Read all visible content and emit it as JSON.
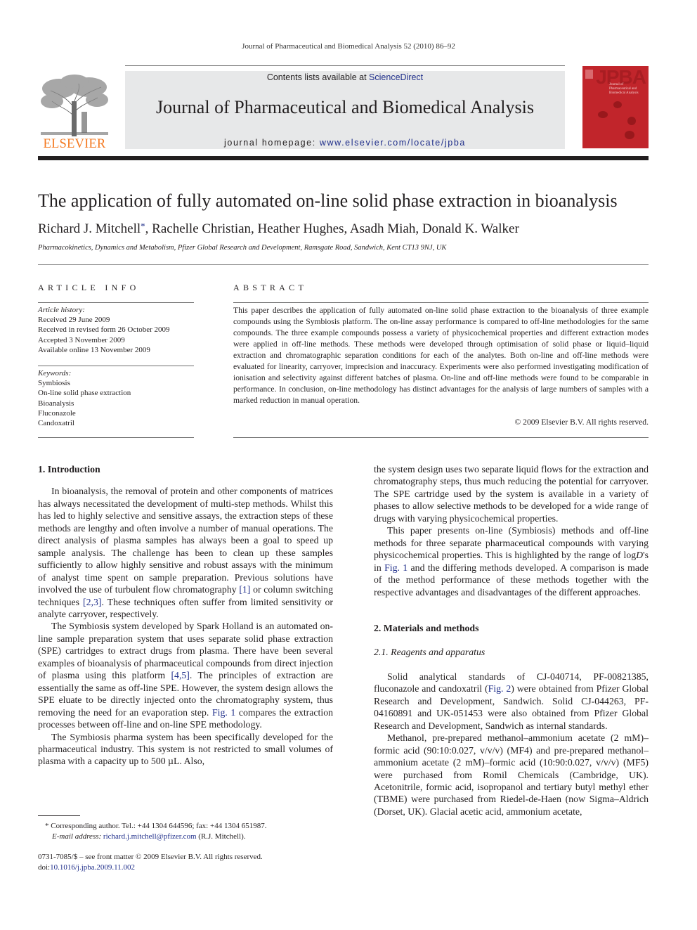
{
  "running_head": "Journal of Pharmaceutical and Biomedical Analysis 52 (2010) 86–92",
  "masthead": {
    "publisher_logo": "elsevier-tree-logo",
    "publisher_name": "ELSEVIER",
    "contents_prefix": "Contents lists available at ",
    "contents_link": "ScienceDirect",
    "journal_title": "Journal of Pharmaceutical and Biomedical Analysis",
    "homepage_prefix": "journal homepage: ",
    "homepage_link": "www.elsevier.com/locate/jpba",
    "cover_title": "JPBA",
    "cover_subtitle": "Journal of Pharmaceutical and Biomedical Analysis",
    "brand_orange": "#f47920",
    "cover_red": "#c1252b",
    "link_color": "#1f2e8a"
  },
  "article": {
    "title": "The application of fully automated on-line solid phase extraction in bioanalysis",
    "authors_first": "Richard J. Mitchell",
    "corresponding_mark": "*",
    "authors_rest": ", Rachelle Christian, Heather Hughes, Asadh Miah, Donald K. Walker",
    "affiliation": "Pharmacokinetics, Dynamics and Metabolism, Pfizer Global Research and Development, Ramsgate Road, Sandwich, Kent CT13 9NJ, UK"
  },
  "article_info": {
    "heading": "ARTICLE INFO",
    "history_label": "Article history:",
    "history": [
      "Received 29 June 2009",
      "Received in revised form 26 October 2009",
      "Accepted 3 November 2009",
      "Available online 13 November 2009"
    ],
    "keywords_label": "Keywords:",
    "keywords": [
      "Symbiosis",
      "On-line solid phase extraction",
      "Bioanalysis",
      "Fluconazole",
      "Candoxatril"
    ]
  },
  "abstract": {
    "heading": "ABSTRACT",
    "text": "This paper describes the application of fully automated on-line solid phase extraction to the bioanalysis of three example compounds using the Symbiosis platform. The on-line assay performance is compared to off-line methodologies for the same compounds. The three example compounds possess a variety of physicochemical properties and different extraction modes were applied in off-line methods. These methods were developed through optimisation of solid phase or liquid–liquid extraction and chromatographic separation conditions for each of the analytes. Both on-line and off-line methods were evaluated for linearity, carryover, imprecision and inaccuracy. Experiments were also performed investigating modification of ionisation and selectivity against different batches of plasma. On-line and off-line methods were found to be comparable in performance. In conclusion, on-line methodology has distinct advantages for the analysis of large numbers of samples with a marked reduction in manual operation.",
    "copyright": "© 2009 Elsevier B.V. All rights reserved."
  },
  "body": {
    "sec1_heading": "1.  Introduction",
    "p1_a": "In bioanalysis, the removal of protein and other components of matrices has always necessitated the development of multi-step methods. Whilst this has led to highly selective and sensitive assays, the extraction steps of these methods are lengthy and often involve a number of manual operations. The direct analysis of plasma samples has always been a goal to speed up sample analysis. The challenge has been to clean up these samples sufficiently to allow highly sensitive and robust assays with the minimum of analyst time spent on sample preparation. Previous solutions have involved the use of turbulent flow chromatography ",
    "p1_ref1": "[1]",
    "p1_b": " or column switching techniques ",
    "p1_ref2": "[2,3]",
    "p1_c": ". These techniques often suffer from limited sensitivity or analyte carryover, respectively.",
    "p2_a": "The Symbiosis system developed by Spark Holland is an automated on-line sample preparation system that uses separate solid phase extraction (SPE) cartridges to extract drugs from plasma. There have been several examples of bioanalysis of pharmaceutical compounds from direct injection of plasma using this platform ",
    "p2_ref": "[4,5]",
    "p2_b": ". The principles of extraction are essentially the same as off-line SPE. However, the system design allows the SPE eluate to be directly injected onto the chromatography system, thus removing the need for an evaporation step. ",
    "p2_fig": "Fig. 1",
    "p2_c": " compares the extraction processes between off-line and on-line SPE methodology.",
    "p3": "The Symbiosis pharma system has been specifically developed for the pharmaceutical industry. This system is not restricted to small volumes of plasma with a capacity up to 500 µL. Also,",
    "p4": "the system design uses two separate liquid flows for the extraction and chromatography steps, thus much reducing the potential for carryover. The SPE cartridge used by the system is available in a variety of phases to allow selective methods to be developed for a wide range of drugs with varying physicochemical properties.",
    "p5_a": "This paper presents on-line (Symbiosis) methods and off-line methods for three separate pharmaceutical compounds with varying physicochemical properties. This is highlighted by the range of log",
    "p5_d": "D",
    "p5_b": "'s in ",
    "p5_fig": "Fig. 1",
    "p5_c": " and the differing methods developed. A comparison is made of the method performance of these methods together with the respective advantages and disadvantages of the different approaches.",
    "sec2_heading": "2.  Materials and methods",
    "sub21_heading": "2.1.  Reagents and apparatus",
    "p6_a": "Solid analytical standards of CJ-040714, PF-00821385, fluconazole and candoxatril (",
    "p6_fig": "Fig. 2",
    "p6_b": ") were obtained from Pfizer Global Research and Development, Sandwich. Solid CJ-044263, PF-04160891 and UK-051453 were also obtained from Pfizer Global Research and Development, Sandwich as internal standards.",
    "p7": "Methanol, pre-prepared methanol–ammonium acetate (2 mM)–formic acid (90:10:0.027, v/v/v) (MF4) and pre-prepared methanol–ammonium acetate (2 mM)–formic acid (10:90:0.027, v/v/v) (MF5) were purchased from Romil Chemicals (Cambridge, UK). Acetonitrile, formic acid, isopropanol and tertiary butyl methyl ether (TBME) were purchased from Riedel-de-Haen (now Sigma–Aldrich (Dorset, UK). Glacial acetic acid, ammonium acetate,"
  },
  "footnote": {
    "mark": "*",
    "text": " Corresponding author. Tel.: +44 1304 644596; fax: +44 1304 651987.",
    "email_label": "E-mail address:",
    "email": "richard.j.mitchell@pfizer.com",
    "email_suffix": " (R.J. Mitchell)."
  },
  "front_matter": {
    "issn_line": "0731-7085/$ – see front matter © 2009 Elsevier B.V. All rights reserved.",
    "doi_prefix": "doi:",
    "doi": "10.1016/j.jpba.2009.11.002"
  }
}
